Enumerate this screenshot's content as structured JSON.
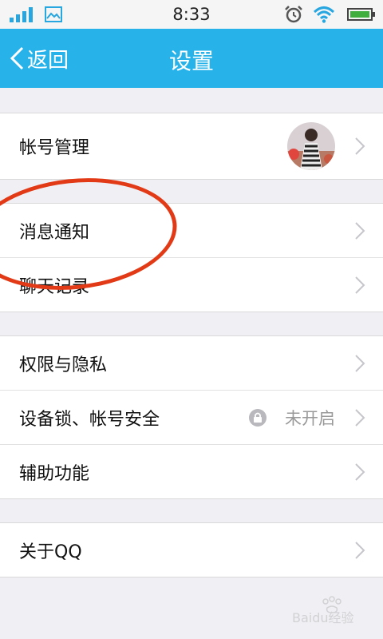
{
  "status_bar": {
    "time": "8:33"
  },
  "nav": {
    "back_label": "返回",
    "title": "设置"
  },
  "groups": [
    {
      "rows": [
        {
          "label": "帐号管理"
        }
      ]
    },
    {
      "rows": [
        {
          "label": "消息通知"
        },
        {
          "label": "聊天记录"
        }
      ]
    },
    {
      "rows": [
        {
          "label": "权限与隐私"
        },
        {
          "label": "设备锁、帐号安全",
          "status": "未开启"
        },
        {
          "label": "辅助功能"
        }
      ]
    },
    {
      "rows": [
        {
          "label": "关于QQ"
        }
      ]
    }
  ],
  "watermark": "Baidu经验",
  "colors": {
    "nav_bg": "#27b3ea",
    "page_bg": "#efeff4",
    "annotation": "#e23a16"
  }
}
